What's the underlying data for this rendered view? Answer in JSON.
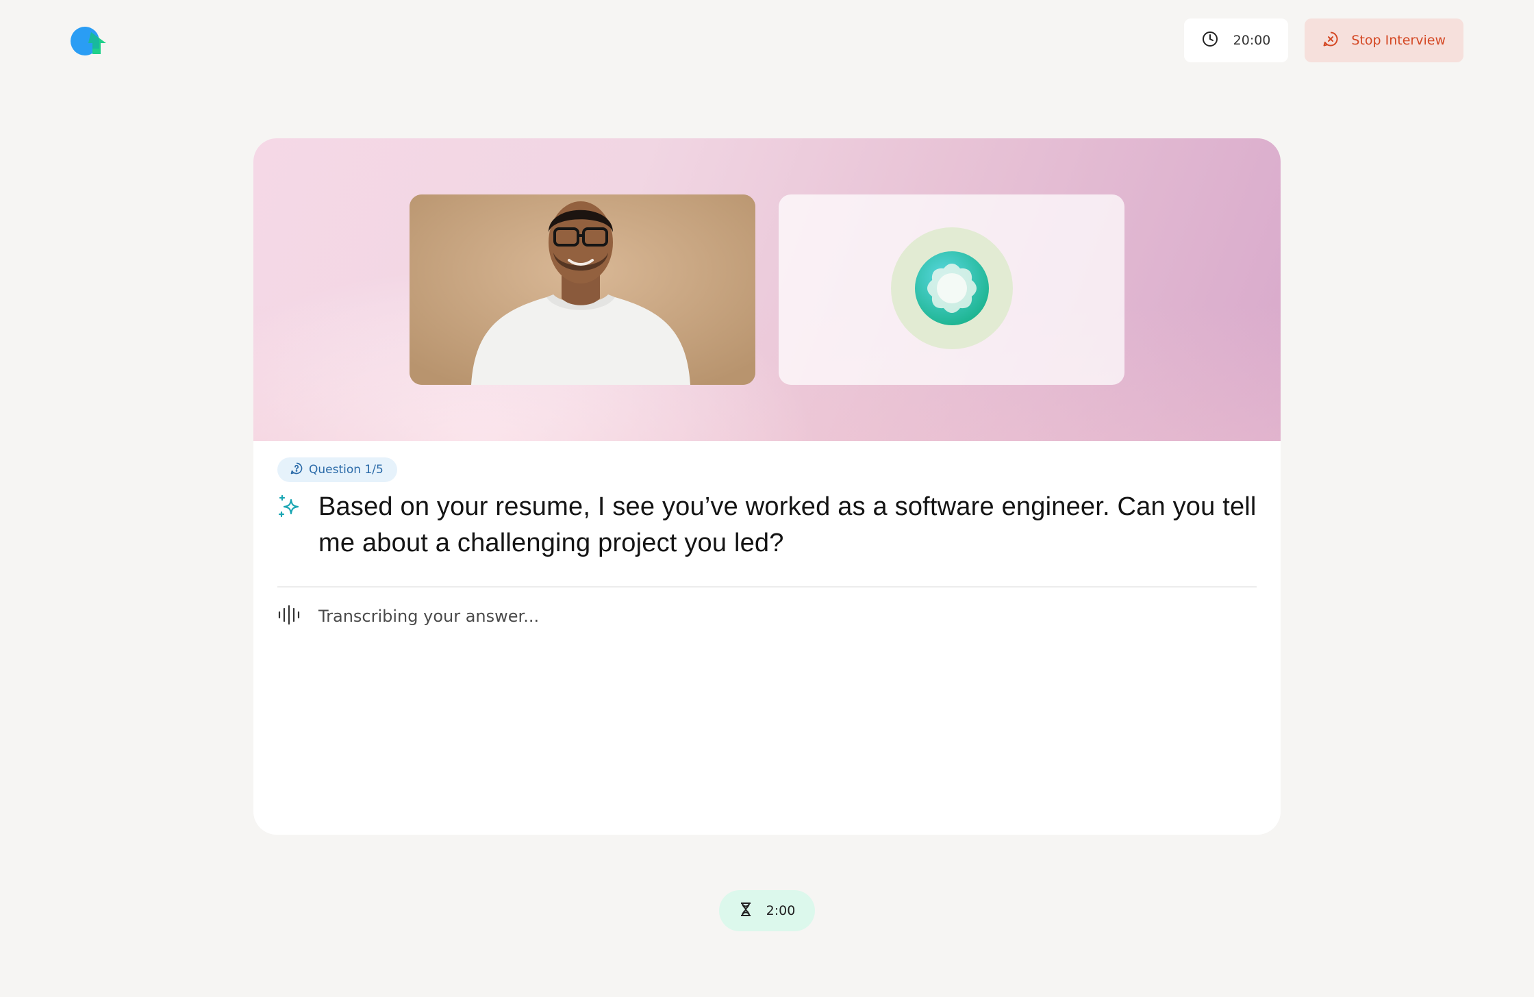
{
  "header": {
    "logo_icon": "brand-logo-icon",
    "timer": {
      "icon": "clock-icon",
      "value": "20:00"
    },
    "stop_button": {
      "icon": "chat-x-icon",
      "label": "Stop Interview"
    }
  },
  "video": {
    "user_tile": {
      "icon": "user-camera-feed"
    },
    "ai_tile": {
      "icon": "ai-orb-icon"
    }
  },
  "question": {
    "badge_icon": "chat-question-icon",
    "badge_label": "Question 1/5",
    "sparkle_icon": "sparkle-icon",
    "text": "Based on your resume, I see you’ve worked as a software engineer. Can you tell me about a challenging project you led?"
  },
  "transcription": {
    "icon": "audio-wave-icon",
    "status": "Transcribing your answer..."
  },
  "answer_timer": {
    "icon": "hourglass-icon",
    "value": "2:00"
  },
  "colors": {
    "background": "#f6f5f3",
    "stop_accent": "#d44824",
    "stop_bg": "#f6e0dc",
    "badge_bg": "#e6f2fb",
    "timer_bg": "#dcf8ec",
    "ai_teal": "#2ec4b0"
  }
}
